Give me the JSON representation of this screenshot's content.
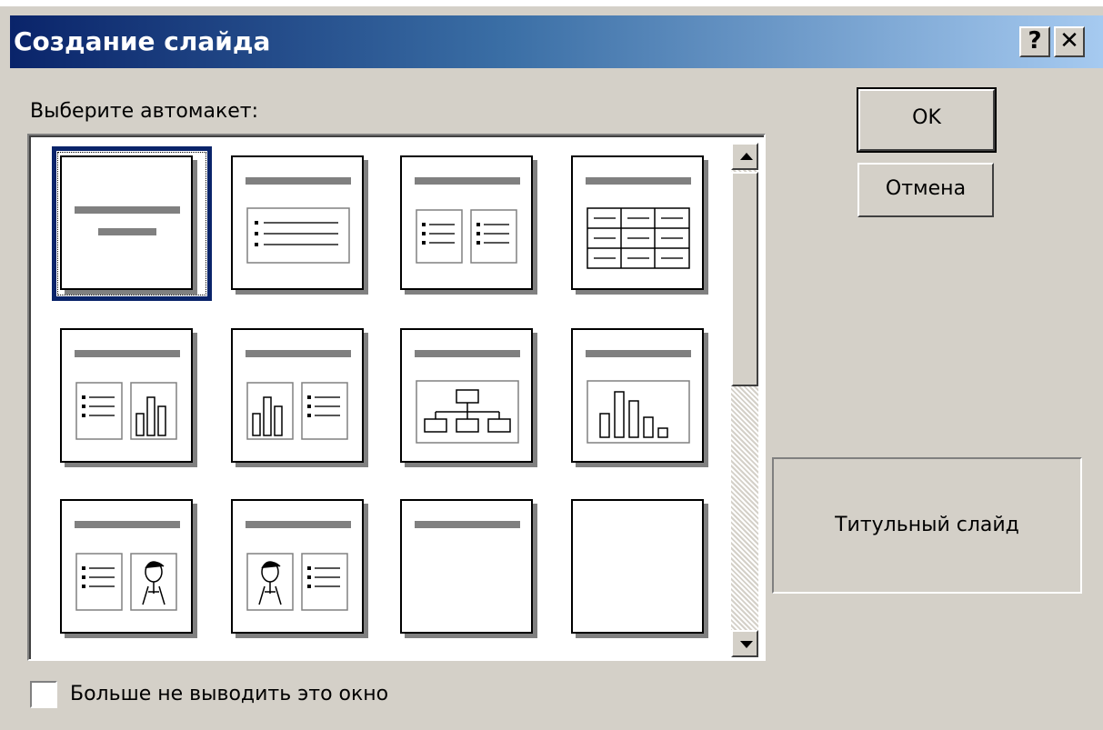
{
  "dialog": {
    "title": "Создание слайда",
    "help_glyph": "?",
    "close_glyph": "✕"
  },
  "chooser": {
    "label": "Выберите автомакет:",
    "layouts": [
      {
        "icon": "title-slide-layout-icon",
        "selected": true
      },
      {
        "icon": "bulleted-list-layout-icon"
      },
      {
        "icon": "two-column-text-layout-icon"
      },
      {
        "icon": "table-layout-icon"
      },
      {
        "icon": "text-and-chart-layout-icon"
      },
      {
        "icon": "chart-and-text-layout-icon"
      },
      {
        "icon": "organization-chart-layout-icon"
      },
      {
        "icon": "chart-layout-icon"
      },
      {
        "icon": "text-and-clip-art-layout-icon"
      },
      {
        "icon": "clip-art-and-text-layout-icon"
      },
      {
        "icon": "title-only-layout-icon"
      },
      {
        "icon": "blank-layout-icon"
      }
    ]
  },
  "buttons": {
    "ok": "OK",
    "cancel": "Отмена"
  },
  "preview": {
    "name": "Титульный слайд"
  },
  "checkbox": {
    "label": "Больше не выводить это окно",
    "checked": false
  },
  "colors": {
    "title_gradient_start": "#0a246a",
    "title_gradient_end": "#a6caf0",
    "dialog_face": "#d4d0c8"
  }
}
